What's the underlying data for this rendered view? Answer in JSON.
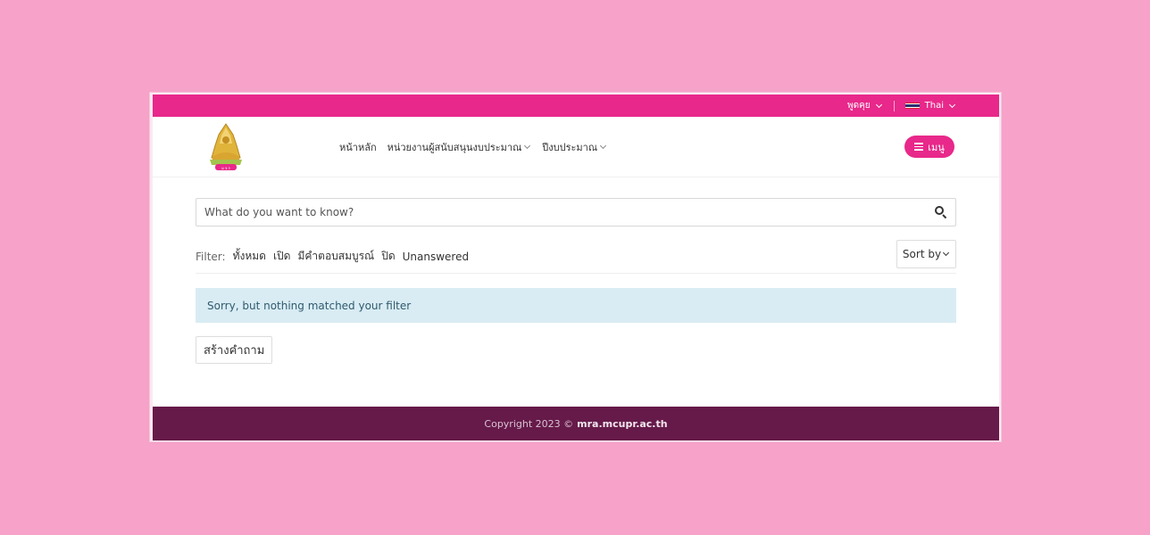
{
  "topbar": {
    "chat_label": "พูดคุย",
    "language_label": "Thai"
  },
  "header": {
    "nav": [
      {
        "label": "หน้าหลัก",
        "dropdown": false
      },
      {
        "label": "หน่วยงานผู้สนับสนุนงบประมาณ",
        "dropdown": true
      },
      {
        "label": "ปีงบประมาณ",
        "dropdown": true
      }
    ],
    "menu_label": "เมนู"
  },
  "search": {
    "placeholder": "What do you want to know?"
  },
  "filter": {
    "label": "Filter:",
    "options": [
      "ทั้งหมด",
      "เปิด",
      "มีคำตอบสมบูรณ์",
      "ปิด",
      "Unanswered"
    ],
    "sort_label": "Sort by"
  },
  "alert": {
    "message": "Sorry, but nothing matched your filter"
  },
  "actions": {
    "create_question_label": "สร้างคำถาม"
  },
  "footer": {
    "copyright": "Copyright 2023 ©",
    "site": "mra.mcupr.ac.th"
  },
  "colors": {
    "page_background": "#f6a2c9",
    "brand_pink": "#e8288a",
    "footer": "#661a4a",
    "alert_background": "#d9ecf4"
  }
}
